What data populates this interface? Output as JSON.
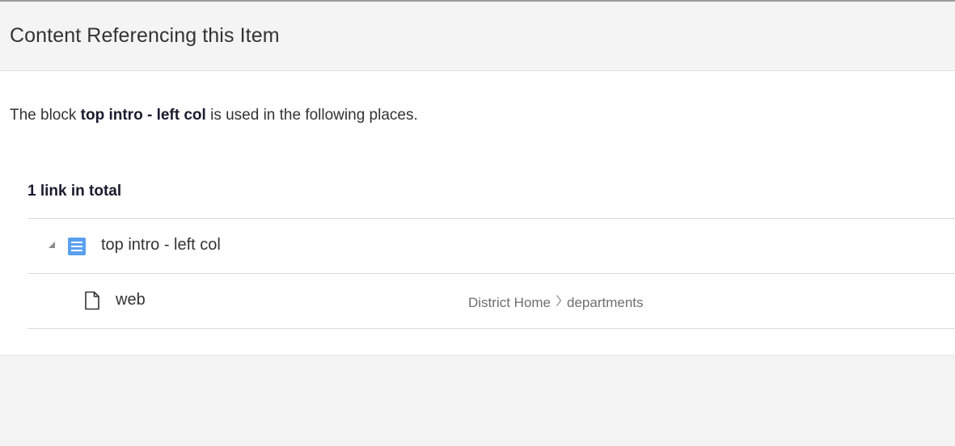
{
  "dialog": {
    "title": "Content Referencing this Item"
  },
  "description": {
    "prefix": "The block ",
    "item_name": "top intro - left col",
    "suffix": " is used in the following places."
  },
  "total_label": "1 link in total",
  "tree": {
    "parent": {
      "label": "top intro - left col",
      "expanded": true,
      "icon": "block-list-icon"
    },
    "children": [
      {
        "label": "web",
        "icon": "page-icon",
        "path": [
          "District Home",
          "departments"
        ]
      }
    ]
  },
  "colors": {
    "block_icon": "#5aa0ef",
    "header_bg": "#f4f4f4",
    "body_bg": "#ffffff",
    "heading_text": "#1b1b2e"
  },
  "icons": {
    "expand": "triangle-down-right-icon",
    "path_separator": "chevron-right-icon"
  }
}
